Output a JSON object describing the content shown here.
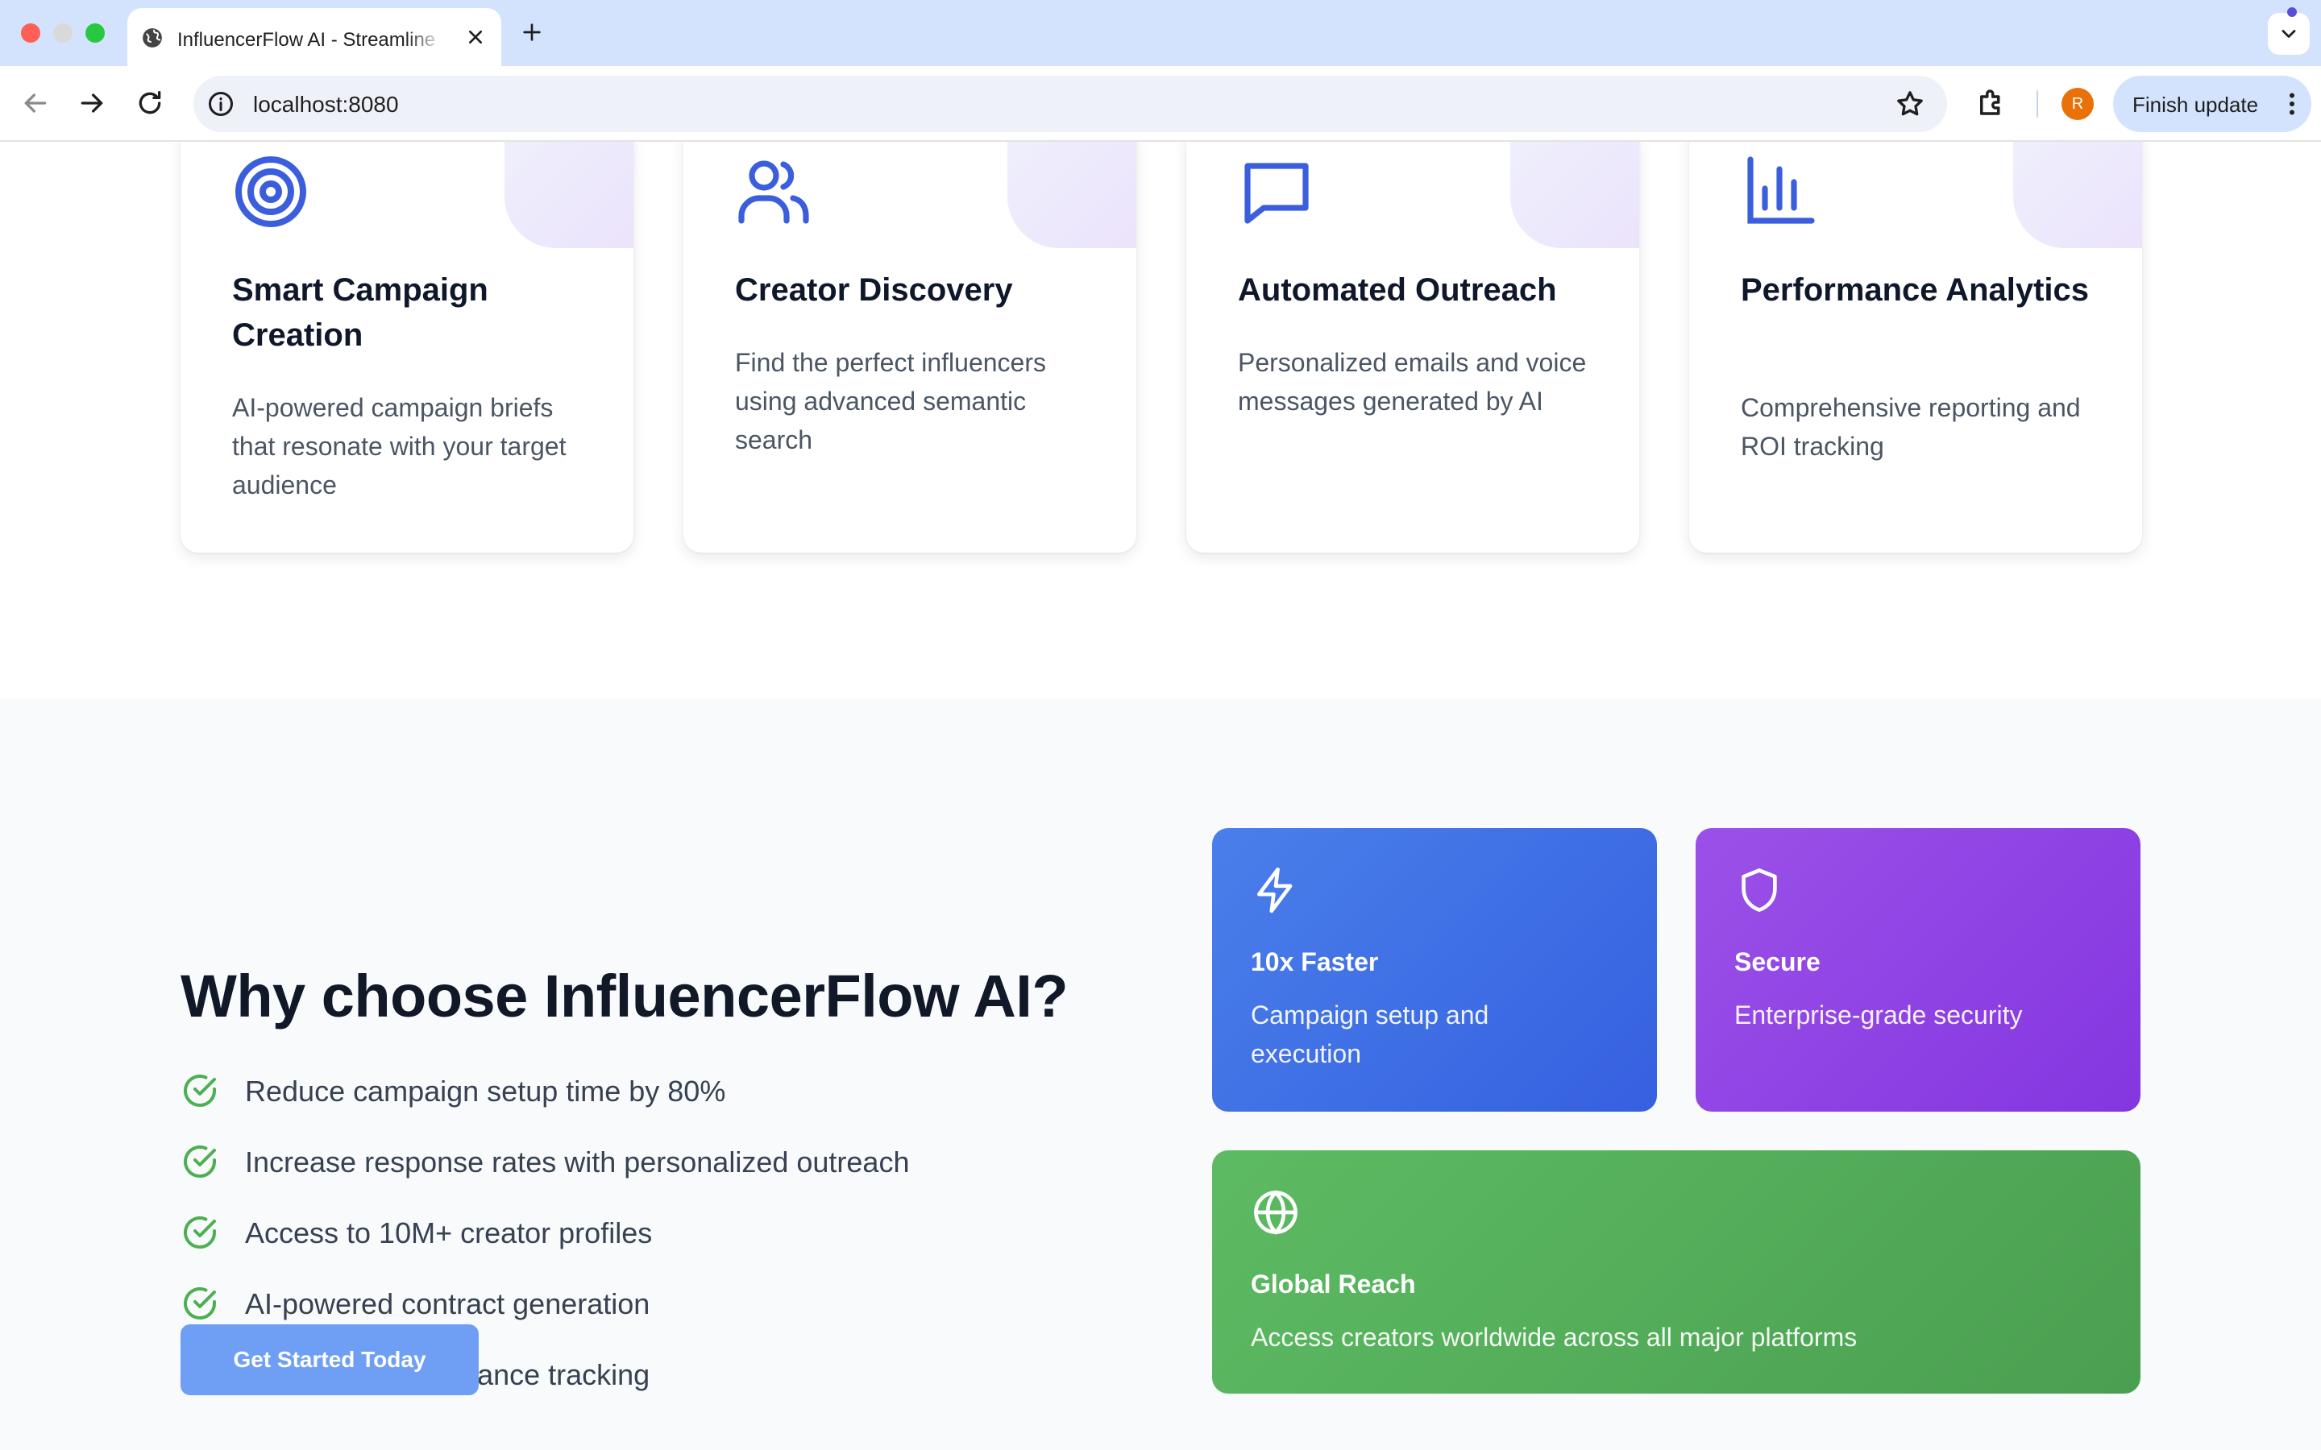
{
  "browser": {
    "tab_title": "InfluencerFlow AI - Streamline",
    "url": "localhost:8080",
    "profile_initial": "R",
    "finish_update_label": "Finish update"
  },
  "features": [
    {
      "title": "Smart Campaign Creation",
      "description": "AI-powered campaign briefs that resonate with your target audience",
      "icon": "target-icon"
    },
    {
      "title": "Creator Discovery",
      "description": "Find the perfect influencers using advanced semantic search",
      "icon": "users-icon"
    },
    {
      "title": "Automated Outreach",
      "description": "Personalized emails and voice messages generated by AI",
      "icon": "message-icon"
    },
    {
      "title": "Performance Analytics",
      "description": "Comprehensive reporting and ROI tracking",
      "icon": "bar-chart-icon"
    }
  ],
  "why": {
    "title": "Why choose InfluencerFlow AI?",
    "benefits": [
      "Reduce campaign setup time by 80%",
      "Increase response rates with personalized outreach",
      "Access to 10M+ creator profiles",
      "AI-powered contract generation",
      "Real-time performance tracking"
    ],
    "cta_label": "Get Started Today"
  },
  "stats": [
    {
      "title": "10x Faster",
      "description": "Campaign setup and execution",
      "icon": "lightning-icon",
      "color_from": "#4a7fea",
      "color_to": "#3560e0"
    },
    {
      "title": "Secure",
      "description": "Enterprise-grade security",
      "icon": "shield-icon",
      "color_from": "#9b51e8",
      "color_to": "#8436e0"
    },
    {
      "title": "Global Reach",
      "description": "Access creators worldwide across all major platforms",
      "icon": "globe-icon",
      "color_from": "#5dbb63",
      "color_to": "#4a9f50"
    }
  ],
  "colors": {
    "accent_blue": "#3b5fdc",
    "check_green": "#4caf50",
    "cta_blue": "#6f9ff5"
  }
}
